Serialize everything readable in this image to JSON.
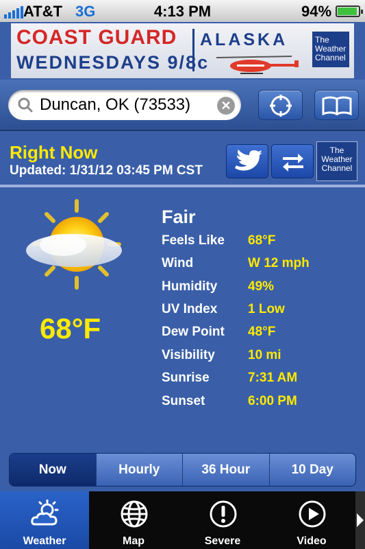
{
  "status_bar": {
    "carrier": "AT&T",
    "network": "3G",
    "time": "4:13 PM",
    "battery": "94%",
    "battery_level": 0.94
  },
  "ad": {
    "line1": "COAST GUARD",
    "line2": "ALASKA",
    "line3": "WEDNESDAYS 9/8c",
    "logo": "The Weather Channel"
  },
  "search": {
    "value": "Duncan, OK (73533)",
    "placeholder": ""
  },
  "header": {
    "title": "Right Now",
    "updated": "Updated: 1/31/12 03:45 PM CST",
    "logo": "The Weather Channel"
  },
  "current": {
    "temperature": "68°F",
    "summary": "Fair",
    "details": [
      {
        "label": "Feels Like",
        "value": "68°F"
      },
      {
        "label": "Wind",
        "value": "W 12 mph"
      },
      {
        "label": "Humidity",
        "value": "49%"
      },
      {
        "label": "UV Index",
        "value": "1 Low"
      },
      {
        "label": "Dew Point",
        "value": "48°F"
      },
      {
        "label": "Visibility",
        "value": "10 mi"
      },
      {
        "label": "Sunrise",
        "value": "7:31 AM"
      },
      {
        "label": "Sunset",
        "value": "6:00 PM"
      }
    ]
  },
  "segments": [
    {
      "label": "Now",
      "active": true
    },
    {
      "label": "Hourly",
      "active": false
    },
    {
      "label": "36 Hour",
      "active": false
    },
    {
      "label": "10 Day",
      "active": false
    }
  ],
  "tabs": [
    {
      "label": "Weather",
      "icon": "weather-icon",
      "active": true
    },
    {
      "label": "Map",
      "icon": "globe-icon",
      "active": false
    },
    {
      "label": "Severe",
      "icon": "alert-icon",
      "active": false
    },
    {
      "label": "Video",
      "icon": "play-icon",
      "active": false
    }
  ],
  "colors": {
    "accent": "#ffea00",
    "background": "#3a5fa8",
    "tab_active": "#2a62c8"
  }
}
